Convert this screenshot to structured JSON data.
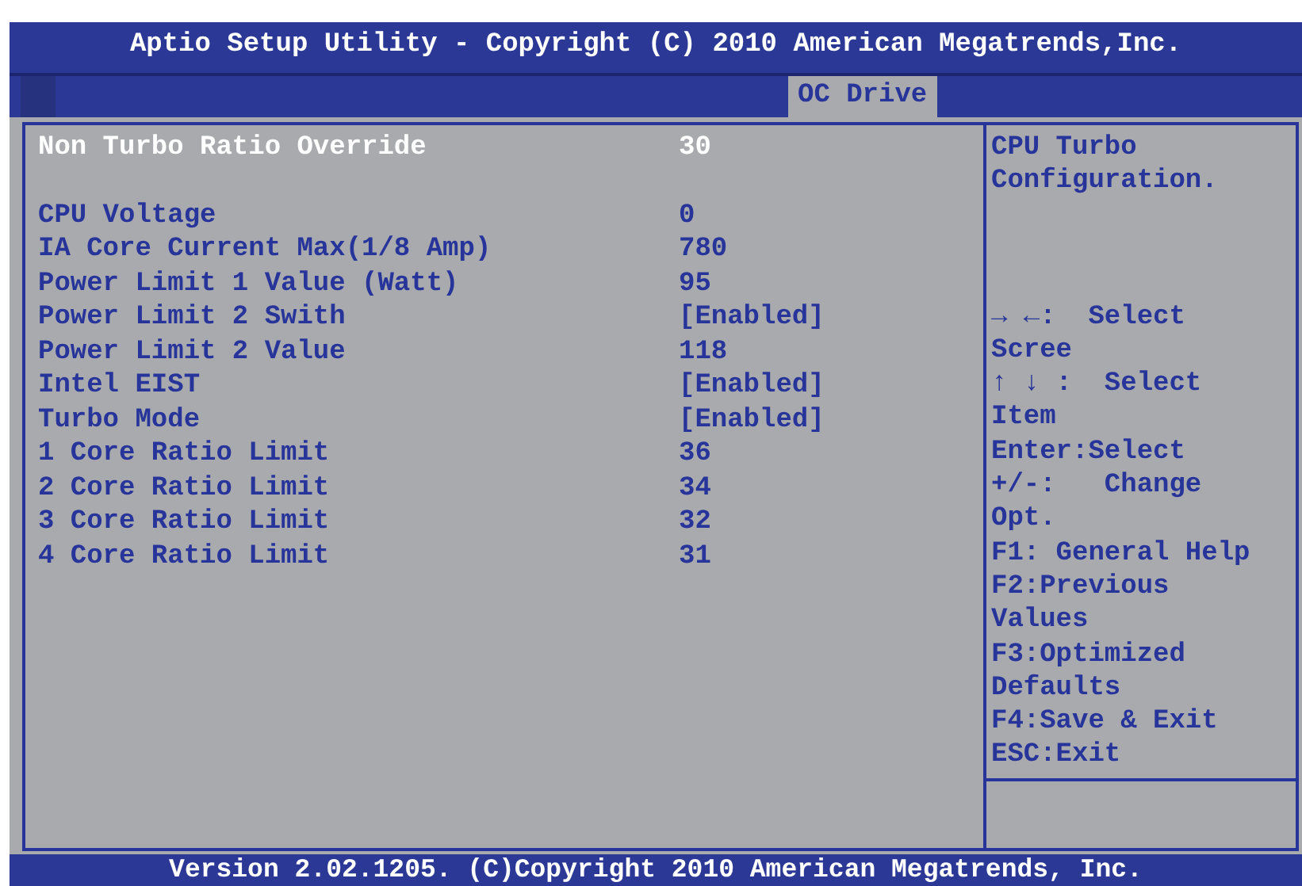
{
  "window": {
    "title": "Aptio Setup Utility - Copyright (C) 2010 American Megatrends,Inc."
  },
  "tabs": [
    {
      "label": "OC Drive",
      "selected": true
    }
  ],
  "setting_groups": [
    [
      {
        "label": "Non Turbo Ratio Override",
        "value": "30",
        "selected": true
      }
    ],
    [
      {
        "label": "CPU Voltage",
        "value": "0",
        "selected": false
      },
      {
        "label": "IA Core Current Max(1/8 Amp)",
        "value": "780",
        "selected": false
      },
      {
        "label": "Power Limit 1 Value (Watt)",
        "value": "95",
        "selected": false
      },
      {
        "label": "Power Limit 2 Swith",
        "value": "[Enabled]",
        "selected": false
      },
      {
        "label": "Power Limit 2 Value",
        "value": "118",
        "selected": false
      },
      {
        "label": "Intel EIST",
        "value": "[Enabled]",
        "selected": false
      },
      {
        "label": "Turbo Mode",
        "value": "[Enabled]",
        "selected": false
      },
      {
        "label": "1 Core Ratio Limit",
        "value": "36",
        "selected": false
      },
      {
        "label": "2 Core Ratio Limit",
        "value": "34",
        "selected": false
      },
      {
        "label": "3 Core Ratio Limit",
        "value": "32",
        "selected": false
      },
      {
        "label": "4 Core Ratio Limit",
        "value": "31",
        "selected": false
      }
    ]
  ],
  "help": {
    "description_lines": [
      "CPU Turbo",
      "Configuration."
    ],
    "key_lines": [
      "→ ←:  Select",
      "Scree",
      "↑ ↓ :  Select",
      "Item",
      "Enter:Select",
      "+/-:   Change",
      "Opt.",
      "F1: General Help",
      "F2:Previous",
      "Values",
      "F3:Optimized",
      "Defaults",
      "F4:Save & Exit",
      "ESC:Exit"
    ]
  },
  "status_bar": "Version 2.02.1205. (C)Copyright 2010 American Megatrends, Inc."
}
